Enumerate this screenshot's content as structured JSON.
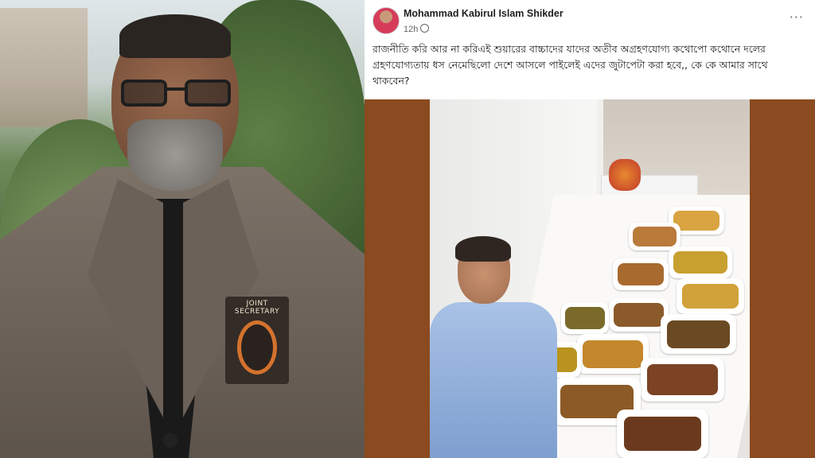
{
  "post": {
    "author": "Mohammad Kabirul Islam Shikder",
    "time": "12h",
    "more_label": "···",
    "text": "রাজনীতি করি আর না করিএই শুয়ারের বাচ্চাদের যাদের অতীব অগ্রহণযোগ্য  কথোপো কথোনে দলের গ্রহণযোগ্যতায় ধস নেমেছিলো দেশে আসলে পাইলেই এদের  জুটাপেটা করা হবে,, কে কে আমার সাথে থাকবেন?"
  },
  "portrait": {
    "badge_text": "JOINT SECRETARY"
  },
  "colors": {
    "post_background": "#8b4a1f",
    "text": "#1c1e21",
    "meta": "#65676b"
  },
  "icons": [
    "globe-icon",
    "more-options-icon"
  ]
}
